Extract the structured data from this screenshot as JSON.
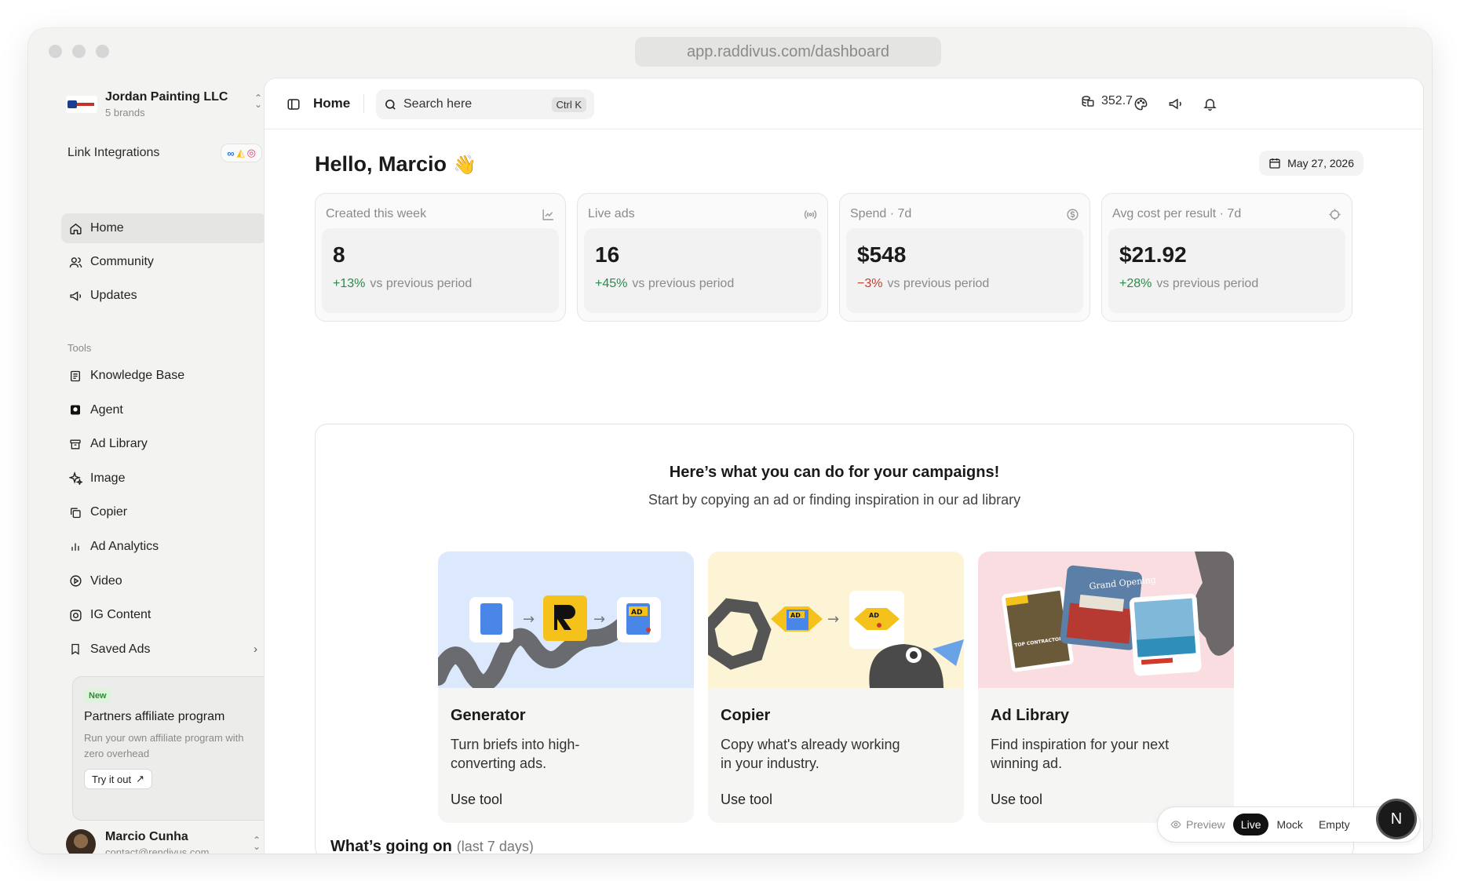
{
  "browser": {
    "url": "app.raddivus.com/dashboard"
  },
  "org": {
    "name": "Jordan Painting LLC",
    "sub": "5 brands"
  },
  "integrations": {
    "label": "Link Integrations"
  },
  "nav": [
    {
      "label": "Home",
      "icon": "home-icon"
    },
    {
      "label": "Community",
      "icon": "users-icon"
    },
    {
      "label": "Updates",
      "icon": "megaphone-icon"
    }
  ],
  "tools_label": "Tools",
  "tools_nav": [
    {
      "label": "Knowledge Base",
      "icon": "book-icon"
    },
    {
      "label": "Agent",
      "icon": "agent-icon"
    },
    {
      "label": "Ad Library",
      "icon": "archive-icon"
    },
    {
      "label": "Image",
      "icon": "sparkles-icon"
    },
    {
      "label": "Copier",
      "icon": "copy-icon"
    },
    {
      "label": "Ad Analytics",
      "icon": "bar-chart-icon"
    },
    {
      "label": "Video",
      "icon": "play-icon"
    },
    {
      "label": "IG Content",
      "icon": "camera-icon"
    },
    {
      "label": "Saved Ads",
      "icon": "bookmark-icon"
    }
  ],
  "promo": {
    "badge": "New",
    "title": "Partners affiliate program",
    "desc": "Run your own affiliate program with zero overhead",
    "button": "Try it out",
    "button_icon": "↗"
  },
  "user": {
    "name": "Marcio Cunha",
    "email": "contact@rendivus.com"
  },
  "topbar": {
    "home": "Home",
    "search": "Search here",
    "shortcut": "Ctrl K",
    "credits": "352.7"
  },
  "greeting": {
    "text": "Hello, Marcio",
    "emoji": "👋",
    "date": "May 27, 2026"
  },
  "stats": [
    {
      "label": "Created this week",
      "value": "8",
      "delta": "+13%",
      "trend": "pos",
      "suffix": "vs previous period",
      "icon": "chart-line-icon"
    },
    {
      "label": "Live ads",
      "value": "16",
      "delta": "+45%",
      "trend": "pos",
      "suffix": "vs previous period",
      "icon": "broadcast-icon"
    },
    {
      "label": "Spend · 7d",
      "value": "$548",
      "delta": "−3%",
      "trend": "neg",
      "suffix": "vs previous period",
      "icon": "dollar-icon"
    },
    {
      "label": "Avg cost per result · 7d",
      "value": "$21.92",
      "delta": "+28%",
      "trend": "pos",
      "suffix": "vs previous period",
      "icon": "crosshair-icon"
    }
  ],
  "campaign": {
    "title": "Here’s what you can do for your campaigns!",
    "subtitle": "Start by copying an ad or finding inspiration in our ad library",
    "tools": [
      {
        "name": "Generator",
        "desc": "Turn briefs into high-converting ads.",
        "cta": "Use tool",
        "color": "#dce8fb",
        "art_text": [
          "AD"
        ]
      },
      {
        "name": "Copier",
        "desc": "Copy what's already working in your industry.",
        "cta": "Use tool",
        "color": "#fcf4d4",
        "art_text": [
          "AD",
          "AD"
        ]
      },
      {
        "name": "Ad Library",
        "desc": "Find inspiration for your next winning ad.",
        "cta": "Use tool",
        "color": "#f9dde0",
        "art_text": [
          "Grand Opening",
          "TOP CONTRACTOR COMPANY IN NEW JERSEY"
        ]
      }
    ]
  },
  "activity": {
    "title": "What’s going on",
    "range": "(last 7 days)"
  },
  "modes": {
    "items": [
      "Preview",
      "Live",
      "Mock",
      "Empty"
    ],
    "active": "Live"
  },
  "fab": {
    "label": "N"
  },
  "colors": {
    "positive": "#2b8a4a",
    "negative": "#d0392b",
    "active_bg": "#e5e5e4"
  }
}
